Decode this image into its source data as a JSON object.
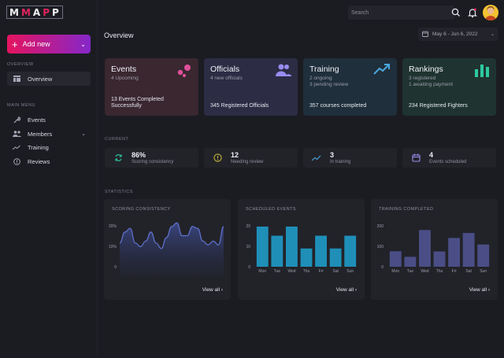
{
  "app": {
    "logo": "MMAPP"
  },
  "sidebar": {
    "new_button": "Add new",
    "overview_section": "OVERVIEW",
    "overview_item": "Overview",
    "main_section": "MAIN MENU",
    "items": [
      {
        "label": "Events",
        "icon": "calendar-icon"
      },
      {
        "label": "Members",
        "icon": "users-icon"
      },
      {
        "label": "Training",
        "icon": "trend-icon"
      },
      {
        "label": "Reviews",
        "icon": "alert-circle-icon"
      }
    ]
  },
  "header": {
    "search_placeholder": "Search",
    "page_title": "Overview",
    "date_range": "May 6 - Jun 6, 2022"
  },
  "cards": [
    {
      "title": "Events",
      "sub": "4 Upcoming",
      "bottom": "13 Events Completed Successfully",
      "color": "#e0509a"
    },
    {
      "title": "Officials",
      "sub": "4 new officials",
      "bottom": "345 Registered Officials",
      "color": "#9a8cf0"
    },
    {
      "title": "Training",
      "sub": "2 ongoing",
      "sub2": "3 pending review",
      "bottom": "357 courses completed",
      "color": "#4aa8e0"
    },
    {
      "title": "Rankings",
      "sub": "3 registered",
      "sub2": "1 awaiting payment",
      "bottom": "234 Registered Fighters",
      "color": "#2ec9a0"
    }
  ],
  "current": {
    "label": "CURRENT",
    "stats": [
      {
        "value": "86%",
        "label": "Scoring consistency"
      },
      {
        "value": "12",
        "label": "Needing review"
      },
      {
        "value": "3",
        "label": "In training"
      },
      {
        "value": "4",
        "label": "Events scheduled"
      }
    ]
  },
  "statistics": {
    "label": "STATISTICS",
    "view_all": "View all",
    "panels": [
      {
        "title": "SCORING CONSISTENCY"
      },
      {
        "title": "SCHEDULED EVENTS"
      },
      {
        "title": "TRAINING COMPLETED"
      }
    ]
  },
  "chart_data": [
    {
      "type": "area",
      "title": "SCORING CONSISTENCY",
      "yticks": [
        "20%",
        "10%",
        "0"
      ],
      "ylim": [
        0,
        25
      ],
      "x": [
        0,
        1,
        2,
        3,
        4,
        5,
        6,
        7,
        8,
        9,
        10,
        11,
        12,
        13,
        14,
        15,
        16,
        17,
        18,
        19,
        20
      ],
      "values": [
        13,
        19,
        21,
        13,
        11,
        14,
        19,
        13,
        10,
        16,
        22,
        24,
        17,
        17,
        22,
        21,
        14,
        12,
        14,
        12,
        22
      ],
      "color": "#5e6fc8"
    },
    {
      "type": "bar",
      "title": "SCHEDULED EVENTS",
      "categories": [
        "Mon",
        "Tue",
        "Wed",
        "Thu",
        "Fri",
        "Sat",
        "Sun"
      ],
      "values": [
        22,
        17,
        22,
        10,
        17,
        10,
        17
      ],
      "yticks": [
        "20",
        "10",
        "0"
      ],
      "ylim": [
        0,
        25
      ],
      "color": "#1f8fb8"
    },
    {
      "type": "bar",
      "title": "TRAINING COMPLETED",
      "categories": [
        "Mon",
        "Tue",
        "Wed",
        "Thu",
        "Fri",
        "Sat",
        "Sun"
      ],
      "values": [
        78,
        50,
        185,
        77,
        145,
        170,
        112
      ],
      "yticks": [
        "200",
        "100",
        "0"
      ],
      "ylim": [
        0,
        230
      ],
      "color": "#4b4e86"
    }
  ]
}
